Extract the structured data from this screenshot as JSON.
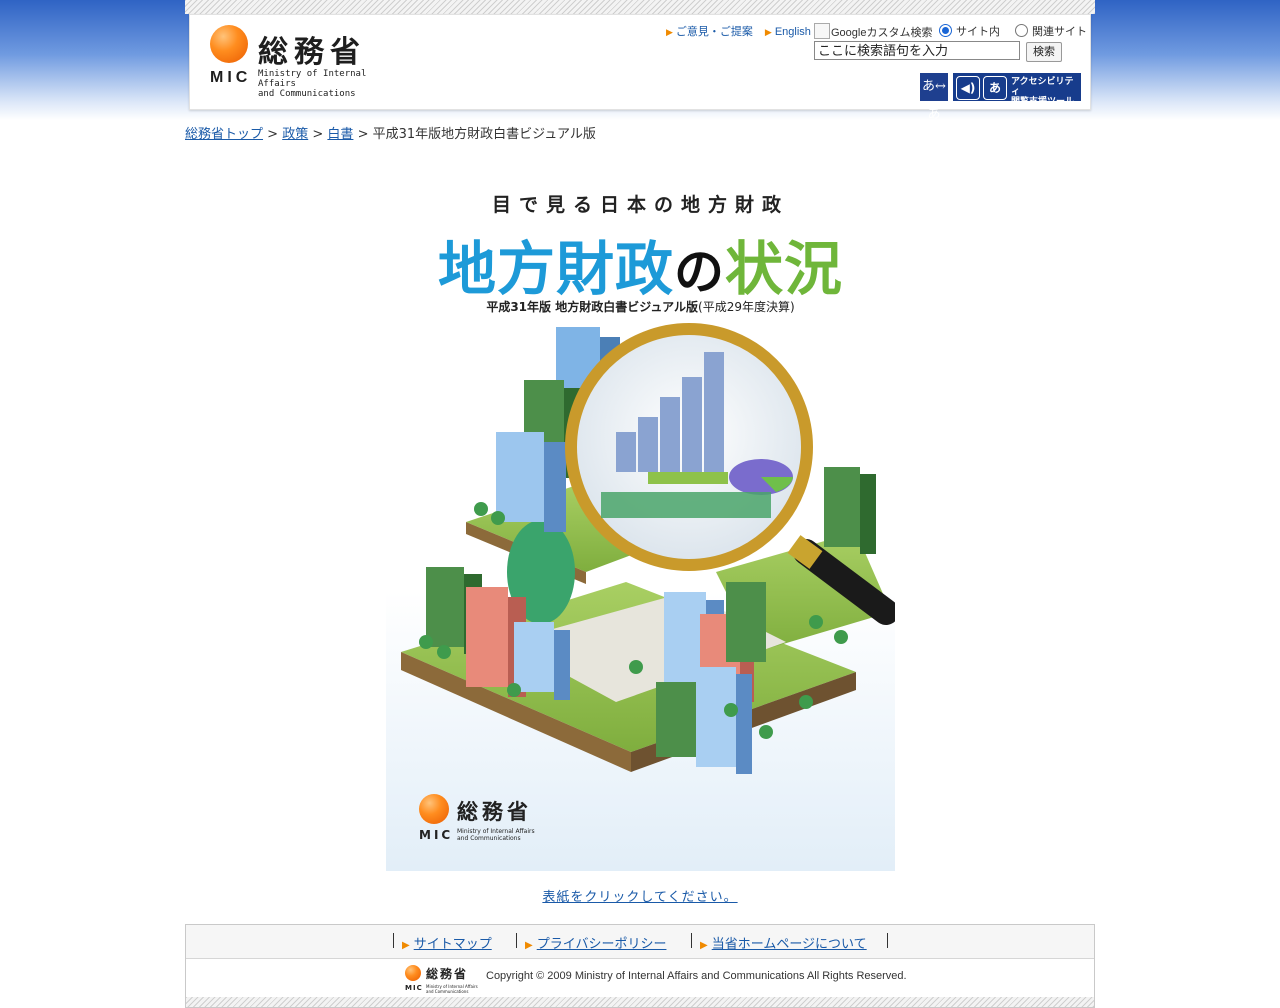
{
  "header": {
    "logo": {
      "kanji": "総務省",
      "mic": "MIC",
      "english_line1": "Ministry of Internal Affairs",
      "english_line2": "and Communications"
    },
    "links": [
      {
        "label": "ご意見・ご提案"
      },
      {
        "label": "English"
      }
    ],
    "search": {
      "google_label": "Googleカスタム検索",
      "radio_site": "サイト内",
      "radio_related": "関連サイト",
      "input_value": "ここに検索語句を入力",
      "button_label": "検索"
    },
    "tools": {
      "font_size_icon_text": "あ↔あ",
      "accessibility_line1": "アクセシビリティ",
      "accessibility_line2": "閲覧支援ツール"
    }
  },
  "breadcrumb": {
    "items": [
      "総務省トップ",
      "政策",
      "白書"
    ],
    "current": "平成31年版地方財政白書ビジュアル版",
    "separator": ">"
  },
  "cover": {
    "subtitle": "目で見る日本の地方財政",
    "title_part1": "地方財政",
    "title_part2": "の",
    "title_part3": "状況",
    "edition": "平成31年版 地方財政白書ビジュアル版",
    "edition_note": "(平成29年度決算)",
    "logo_kanji": "総務省",
    "logo_mic": "MIC",
    "logo_english_line1": "Ministry of Internal Affairs",
    "logo_english_line2": "and Communications"
  },
  "click_prompt": "表紙をクリックしてください。",
  "footer": {
    "nav": [
      {
        "label": "サイトマップ"
      },
      {
        "label": "プライバシーポリシー"
      },
      {
        "label": "当省ホームページについて"
      }
    ],
    "logo_kanji": "総務省",
    "logo_mic": "MIC",
    "logo_english_line1": "Ministry of Internal Affairs",
    "logo_english_line2": "and Communications",
    "copyright": "Copyright © 2009 Ministry of Internal Affairs and Communications All Rights Reserved."
  },
  "colors": {
    "brand_orange": "#ff8d1f",
    "link_blue": "#1a5aa8",
    "title_blue": "#1d9ad8",
    "title_green": "#6fb63a",
    "tool_navy": "#173c8c"
  }
}
